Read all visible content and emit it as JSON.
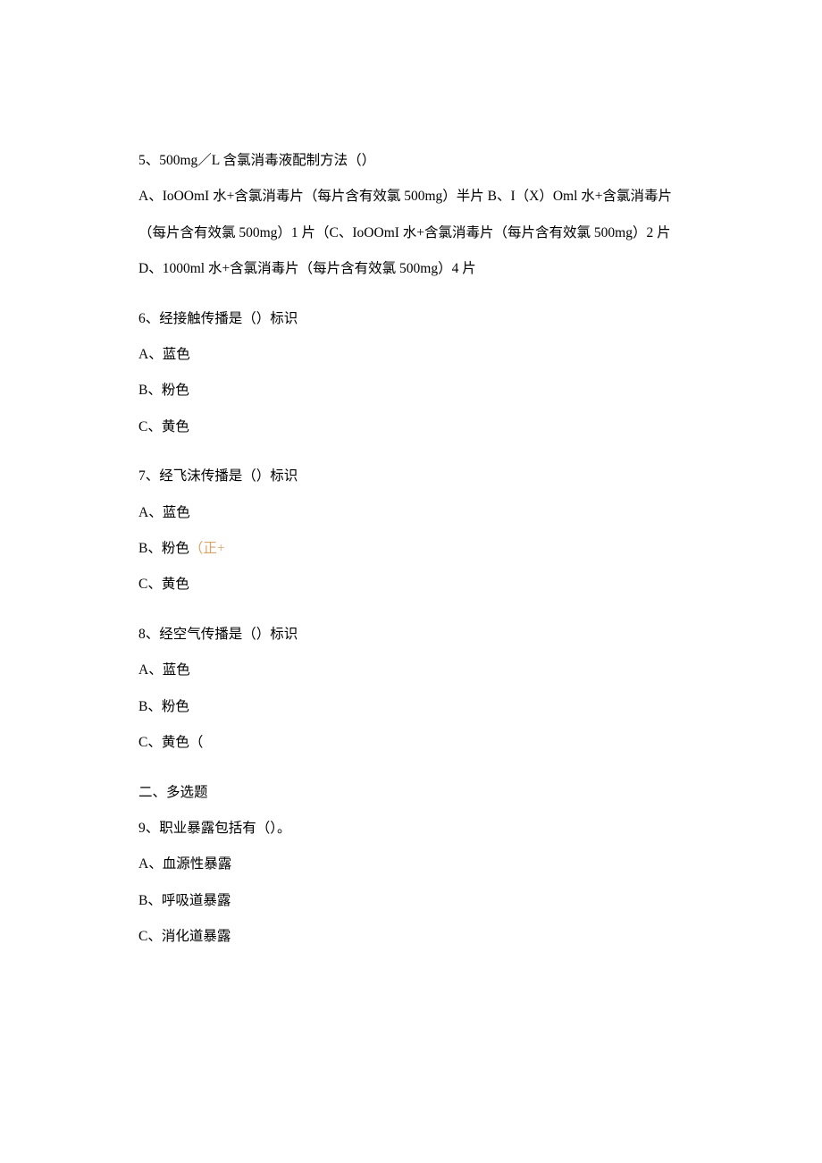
{
  "questions": [
    {
      "q_line": "5、500mg／L 含氯消毒液配制方法（）",
      "option_lines": [
        "A、IoOOmI 水+含氯消毒片（每片含有效氯 500mg）半片 B、I（X）Oml 水+含氯消毒片（每片含有效氯 500mg）1 片（C、IoOOmI 水+含氯消毒片（每片含有效氯 500mg）2 片",
        "D、1000ml 水+含氯消毒片（每片含有效氯 500mg）4 片"
      ]
    },
    {
      "q_line": "6、经接触传播是（）标识",
      "option_lines": [
        "A、蓝色",
        "B、粉色",
        "C、黄色"
      ]
    },
    {
      "q_line": "7、经飞沫传播是（）标识",
      "option_lines": [
        "A、蓝色",
        {
          "prefix": "B、粉色",
          "hint": "（正+"
        },
        "C、黄色"
      ]
    },
    {
      "q_line": "8、经空气传播是（）标识",
      "option_lines": [
        "A、蓝色",
        "B、粉色",
        "C、黄色（"
      ]
    }
  ],
  "section2_header": "二、多选题",
  "question9": {
    "q_line": "9、职业暴露包括有（）。",
    "option_lines": [
      "A、血源性暴露",
      "B、呼吸道暴露",
      "C、消化道暴露"
    ]
  }
}
